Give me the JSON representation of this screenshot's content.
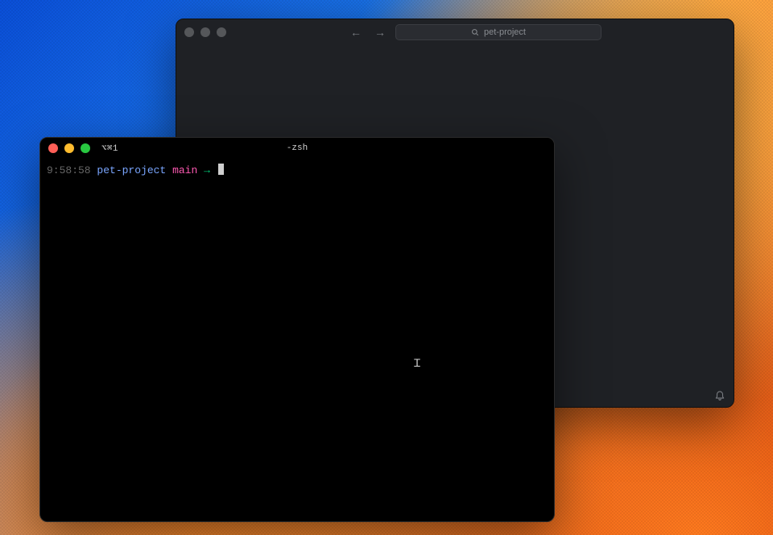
{
  "ide": {
    "search_placeholder": "pet-project"
  },
  "terminal": {
    "tab_label": "⌥⌘1",
    "title": "-zsh",
    "prompt": {
      "time": "9:58:58",
      "directory": "pet-project",
      "branch": "main",
      "arrow": "→"
    }
  },
  "colors": {
    "time": "#666666",
    "directory": "#7aa6ff",
    "branch": "#ff5ab3",
    "arrow": "#00d17a",
    "ide_bg": "#1f2125",
    "terminal_bg": "#000000"
  }
}
